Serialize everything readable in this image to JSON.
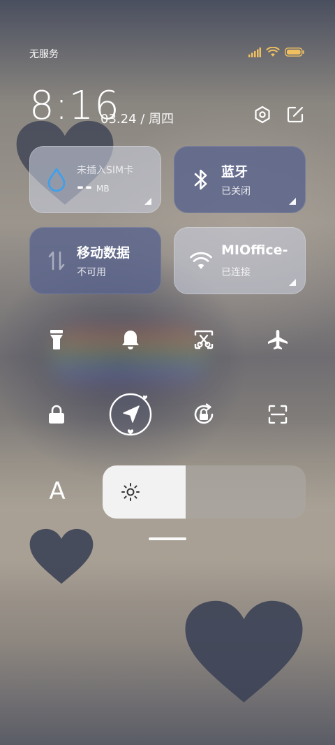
{
  "status_bar": {
    "carrier": "无服务",
    "signal_icon": "signal-bars-icon",
    "wifi_icon": "wifi-icon",
    "battery_icon": "battery-icon",
    "battery_color": "#f0c060"
  },
  "header": {
    "time": "8:16",
    "date": "03.24 / 周四",
    "settings_icon": "settings-hex-icon",
    "edit_icon": "edit-icon"
  },
  "tiles": {
    "sim": {
      "title": "未插入SIM卡",
      "value": "--",
      "unit": "MB",
      "icon": "water-drop-icon",
      "accent": "#3aa0f0"
    },
    "bluetooth": {
      "title": "蓝牙",
      "subtitle": "已关闭",
      "icon": "bluetooth-icon"
    },
    "mobile_data": {
      "title": "移动数据",
      "subtitle": "不可用",
      "icon": "data-arrows-icon"
    },
    "wifi": {
      "title": "MIOffice-",
      "subtitle": "已连接",
      "icon": "wifi-icon"
    }
  },
  "toggles_row1": [
    {
      "icon": "flashlight-icon"
    },
    {
      "icon": "bell-icon"
    },
    {
      "icon": "screenshot-icon"
    },
    {
      "icon": "airplane-icon"
    }
  ],
  "toggles_row2": [
    {
      "icon": "lock-icon"
    },
    {
      "icon": "location-icon"
    },
    {
      "icon": "rotation-lock-icon"
    },
    {
      "icon": "scan-icon"
    }
  ],
  "brightness": {
    "auto_label": "A",
    "level": 0.41,
    "icon": "sun-icon"
  }
}
